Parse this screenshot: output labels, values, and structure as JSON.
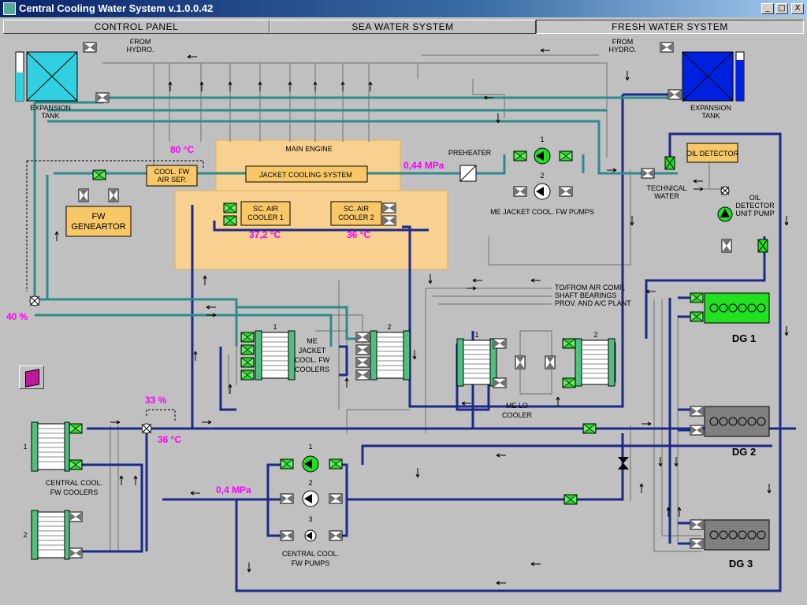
{
  "window": {
    "title": "Central Cooling Water System  v.1.0.0.42",
    "minimize": "_",
    "maximize": "□",
    "close": "X"
  },
  "tabs": [
    "CONTROL PANEL",
    "SEA WATER SYSTEM",
    "FRESH WATER SYSTEM"
  ],
  "active_tab": "FRESH WATER SYSTEM",
  "labels": {
    "from_hydro": [
      "FROM",
      "HYDRO."
    ],
    "expansion_tank": [
      "EXPANSION",
      "TANK"
    ],
    "main_engine": "MAIN ENGINE",
    "jacket_cooling_system": "JACKET COOLING SYSTEM",
    "cool_fw_air_sep": [
      "COOL. FW",
      "AIR SEP."
    ],
    "fw_generator": [
      "FW",
      "GENEARTOR"
    ],
    "preheater": "PREHEATER",
    "sc_air_cooler_1": [
      "SC. AIR",
      "COOLER 1"
    ],
    "sc_air_cooler_2": [
      "SC. AIR",
      "COOLER 2"
    ],
    "me_jacket_cool_fw_pumps": "ME JACKET COOL. FW PUMPS",
    "oil_detector": "OIL DETECTOR",
    "technical_water": [
      "TECHNICAL",
      "WATER"
    ],
    "oil_detector_unit_pump": [
      "OIL",
      "DETECTOR",
      "UNIT PUMP"
    ],
    "to_from_air_comp": [
      "TO/FROM AIR COMP,",
      "SHAFT BEARINGS",
      "PROV. AND A/C PLANT"
    ],
    "me_jacket_cool_fw_coolers": [
      "ME",
      "JACKET",
      "COOL. FW",
      "COOLERS"
    ],
    "me_lo_cooler": [
      "ME  LO",
      "COOLER"
    ],
    "central_cool_fw_coolers": [
      "CENTRAL COOL.",
      "FW COOLERS"
    ],
    "central_cool_fw_pumps": [
      "CENTRAL COOL.",
      "FW PUMPS"
    ],
    "dg1": "DG 1",
    "dg2": "DG 2",
    "dg3": "DG 3",
    "n1": "1",
    "n2": "2",
    "n3": "3"
  },
  "readouts": {
    "temp_80": "80 °C",
    "pres_044": "0,44 MPa",
    "temp_372": "37,2 °C",
    "temp_36a": "36 °C",
    "valve_40": "40 %",
    "valve_33": "33 %",
    "temp_36b": "36 °C",
    "pres_04": "0,4 MPa"
  },
  "colors": {
    "background": "#c0c0c0",
    "fresh_water_pipe": "#1a2a8a",
    "jacket_pipe": "#2e8b8b",
    "engine_zone": "#f8d090",
    "component_box": "#f8c868",
    "valve_open": "#20e020",
    "valve_closed": "#808080",
    "running_pump": "#20e020",
    "readout_text": "#ff00ff",
    "low_tank": "#30d0e0",
    "high_tank": "#0020e0",
    "dg1_running": "#20e020",
    "dg_stopped": "#808080"
  }
}
